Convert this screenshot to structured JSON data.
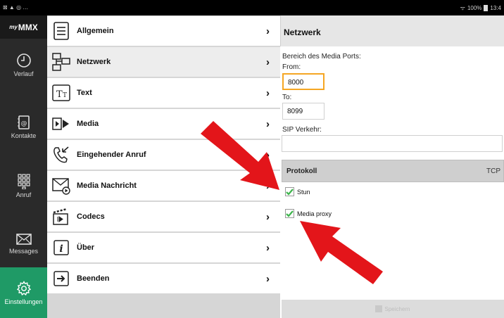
{
  "statusbar": {
    "left_icons": "⊠ ▲ ◎ …",
    "signal": "ᯤ",
    "battery": "100%",
    "time": "13:4"
  },
  "app": {
    "logo_prefix": "my",
    "logo": "MMX"
  },
  "rail": {
    "items": [
      {
        "label": "Verlauf",
        "icon": "clock-icon"
      },
      {
        "label": "Kontakte",
        "icon": "contacts-icon"
      },
      {
        "label": "Anruf",
        "icon": "dialpad-icon"
      },
      {
        "label": "Messages",
        "icon": "envelope-icon"
      },
      {
        "label": "Einstellungen",
        "icon": "gear-icon",
        "active": true
      }
    ]
  },
  "settings_list": [
    {
      "label": "Allgemein",
      "icon": "list-icon"
    },
    {
      "label": "Netzwerk",
      "icon": "network-icon",
      "selected": true
    },
    {
      "label": "Text",
      "icon": "text-icon"
    },
    {
      "label": "Media",
      "icon": "media-icon"
    },
    {
      "label": "Eingehender Anruf",
      "icon": "incoming-call-icon"
    },
    {
      "label": "Media Nachricht",
      "icon": "media-message-icon"
    },
    {
      "label": "Codecs",
      "icon": "codecs-icon"
    },
    {
      "label": "Über",
      "icon": "info-icon"
    },
    {
      "label": "Beenden",
      "icon": "exit-icon"
    }
  ],
  "chevron": "›",
  "detail": {
    "title": "Netzwerk",
    "media_port_label": "Bereich des Media Ports:",
    "from_label": "From:",
    "from_value": "8000",
    "to_label": "To:",
    "to_value": "8099",
    "sip_label": "SIP Verkehr:",
    "sip_value": "",
    "protocol_label": "Protokoll",
    "protocol_value": "TCP",
    "stun_label": "Stun",
    "stun_checked": true,
    "media_proxy_label": "Media proxy",
    "media_proxy_checked": true,
    "save_label": "Speichern"
  },
  "colors": {
    "accent": "#1f9a66",
    "focus": "#f5a623",
    "arrow": "#e3151a",
    "check": "#3cb44b"
  }
}
